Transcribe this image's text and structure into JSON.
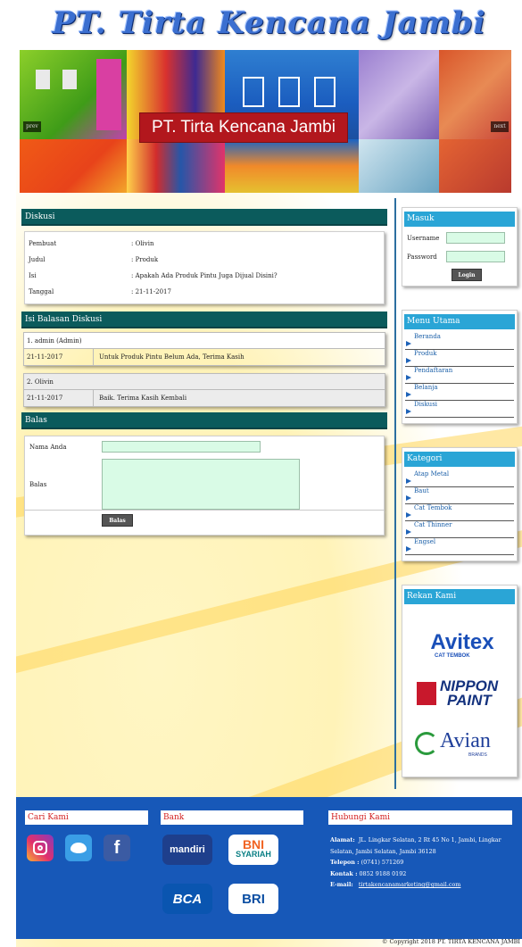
{
  "header": {
    "logo_text": "PT. Tirta Kencana Jambi",
    "banner_caption": "PT. Tirta Kencana Jambi",
    "prev_label": "prev",
    "next_label": "next"
  },
  "diskusi": {
    "title": "Diskusi",
    "rows": [
      {
        "label": "Pembuat",
        "value": ": Olivin"
      },
      {
        "label": "Judul",
        "value": ": Produk"
      },
      {
        "label": "Isi",
        "value": ": Apakah Ada Produk Pintu Juga Dijual Disini?"
      },
      {
        "label": "Tanggal",
        "value": ": 21-11-2017"
      }
    ]
  },
  "replies": {
    "title": "Isi Balasan Diskusi",
    "items": [
      {
        "head": "1. admin (Admin)",
        "date": "21-11-2017",
        "text": "Untuk Produk Pintu Belum Ada, Terima Kasih"
      },
      {
        "head": "2. Olivin",
        "date": "21-11-2017",
        "text": "Baik. Terima Kasih Kembali"
      }
    ]
  },
  "balas": {
    "title": "Balas",
    "name_label": "Nama Anda",
    "name_value": "",
    "reply_label": "Balas",
    "reply_value": "",
    "submit_label": "Balas"
  },
  "login": {
    "title": "Masuk",
    "username_label": "Username",
    "password_label": "Password",
    "button_label": "Login"
  },
  "menu": {
    "title": "Menu Utama",
    "items": [
      "Beranda",
      "Produk",
      "Pendaftaran",
      "Belanja",
      "Diskusi"
    ]
  },
  "kategori": {
    "title": "Kategori",
    "items": [
      "Atap Metal",
      "Baut",
      "Cat Tembok",
      "Cat Thinner",
      "Engsel"
    ]
  },
  "partners": {
    "title": "Rekan Kami",
    "logos": [
      "Avitex",
      "CAT TEMBOK",
      "NIPPON",
      "PAINT",
      "Avian",
      "BRANDS"
    ]
  },
  "footer": {
    "cari_title": "Cari Kami",
    "bank_title": "Bank",
    "kontak_title": "Hubungi Kami",
    "banks": [
      "mandiri",
      "BNI",
      "SYARIAH",
      "BCA",
      "BRI"
    ],
    "alamat_label": "Alamat:",
    "alamat_value": "JL. Lingkar Selatan, 2 Rt 45 No 1, Jambi, Lingkar Selatan, Jambi Selatan, Jambi 36128",
    "telepon_label": "Telepon :",
    "telepon_value": "(0741) 571269",
    "kontak_label": "Kontak :",
    "kontak_value": "0852 9188 0192",
    "email_label": "E-mail:",
    "email_value": "tirtakencanamarketing@gmail.com",
    "copyright": "© Copyright 2018 PT. TIRTA KENCANA JAMBI"
  }
}
